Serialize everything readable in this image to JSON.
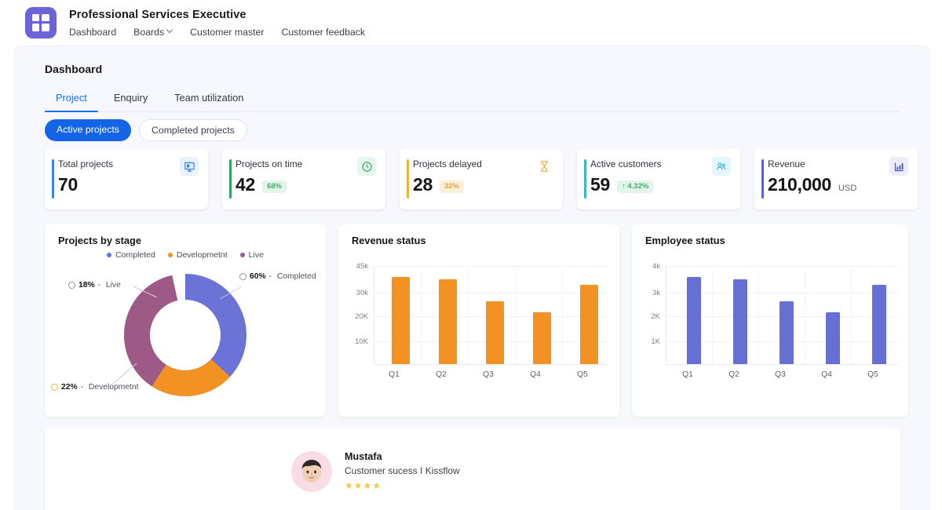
{
  "header": {
    "app_title": "Professional Services Executive",
    "logo_icon": "dashboard-grid-icon",
    "nav": [
      {
        "label": "Dashboard",
        "has_chevron": false
      },
      {
        "label": "Boards",
        "has_chevron": true
      },
      {
        "label": "Customer master",
        "has_chevron": false
      },
      {
        "label": "Customer feedback",
        "has_chevron": false
      }
    ]
  },
  "page": {
    "title": "Dashboard",
    "tabs": [
      {
        "label": "Project",
        "active": true
      },
      {
        "label": "Enquiry",
        "active": false
      },
      {
        "label": "Team utilization",
        "active": false
      }
    ],
    "filters": [
      {
        "label": "Active projects",
        "selected": true
      },
      {
        "label": "Completed projects",
        "selected": false
      }
    ]
  },
  "kpis": [
    {
      "label": "Total projects",
      "value": "70",
      "unit": "",
      "badge": "",
      "badge_type": "",
      "accent": "#3b82f6",
      "icon": "presentation-board-icon",
      "icon_bg": "#e8f1fe",
      "icon_color": "#2f7ced"
    },
    {
      "label": "Projects on time",
      "value": "42",
      "unit": "",
      "badge": "68%",
      "badge_type": "green",
      "accent": "#2fa360",
      "icon": "clock-icon",
      "icon_bg": "#e7f6ec",
      "icon_color": "#3aa76a"
    },
    {
      "label": "Projects delayed",
      "value": "28",
      "unit": "",
      "badge": "32%",
      "badge_type": "amber",
      "accent": "#e8b53c",
      "icon": "hourglass-icon",
      "icon_bg": "#fdf4e0",
      "icon_color": "#e5b13c"
    },
    {
      "label": "Active customers",
      "value": "59",
      "unit": "",
      "badge": "↑ 4.32%",
      "badge_type": "green",
      "accent": "#35b5d8",
      "icon": "people-icon",
      "icon_bg": "#e3f6fc",
      "icon_color": "#3ab6dc"
    },
    {
      "label": "Revenue",
      "value": "210,000",
      "unit": "USD",
      "badge": "",
      "badge_type": "",
      "accent": "#5b5fd0",
      "icon": "bar-chart-icon",
      "icon_bg": "#eceefb",
      "icon_color": "#4b54c6"
    }
  ],
  "chart_data": [
    {
      "type": "pie",
      "title": "Projects by stage",
      "legend": [
        "Completed",
        "Developmetnt",
        "Live"
      ],
      "legend_position": "top-center",
      "categories": [
        "Completed",
        "Developmetnt",
        "Live"
      ],
      "values": [
        60,
        22,
        18
      ],
      "colors": [
        "#6b73d6",
        "#f29222",
        "#9d5a86"
      ],
      "labels": [
        {
          "text": "60% - Completed",
          "percent": "60%",
          "name": "Completed",
          "marker": "neutral"
        },
        {
          "text": "22% - Developmetnt",
          "percent": "22%",
          "name": "Developmetnt",
          "marker": "yellow"
        },
        {
          "text": "18% - Live",
          "percent": "18%",
          "name": "Live",
          "marker": "neutral"
        }
      ],
      "xlabel": "",
      "ylabel": ""
    },
    {
      "type": "bar",
      "title": "Revenue status",
      "categories": [
        "Q1",
        "Q2",
        "Q3",
        "Q4",
        "Q5"
      ],
      "values": [
        39500,
        38500,
        26000,
        22000,
        35500
      ],
      "ytick_labels": [
        "45k",
        "30k",
        "20K",
        "10K"
      ],
      "ytick_values": [
        45000,
        30000,
        20000,
        10000
      ],
      "ylim": [
        0,
        45000
      ],
      "color": "#f29222",
      "grid": true,
      "xlabel": "",
      "ylabel": ""
    },
    {
      "type": "bar",
      "title": "Employee status",
      "categories": [
        "Q1",
        "Q2",
        "Q3",
        "Q4",
        "Q5"
      ],
      "values": [
        3.65,
        3.58,
        2.62,
        2.2,
        3.38
      ],
      "ytick_labels": [
        "4k",
        "3k",
        "2K",
        "1K"
      ],
      "ytick_values": [
        4,
        3,
        2,
        1
      ],
      "ylim": [
        0,
        4
      ],
      "color": "#6670d4",
      "grid": true,
      "xlabel": "",
      "ylabel": ""
    }
  ],
  "testimonial": {
    "avatar": "user-avatar",
    "name": "Mustafa",
    "role": "Customer sucess I Kissflow",
    "rating": 4,
    "stars": "★★★★"
  }
}
